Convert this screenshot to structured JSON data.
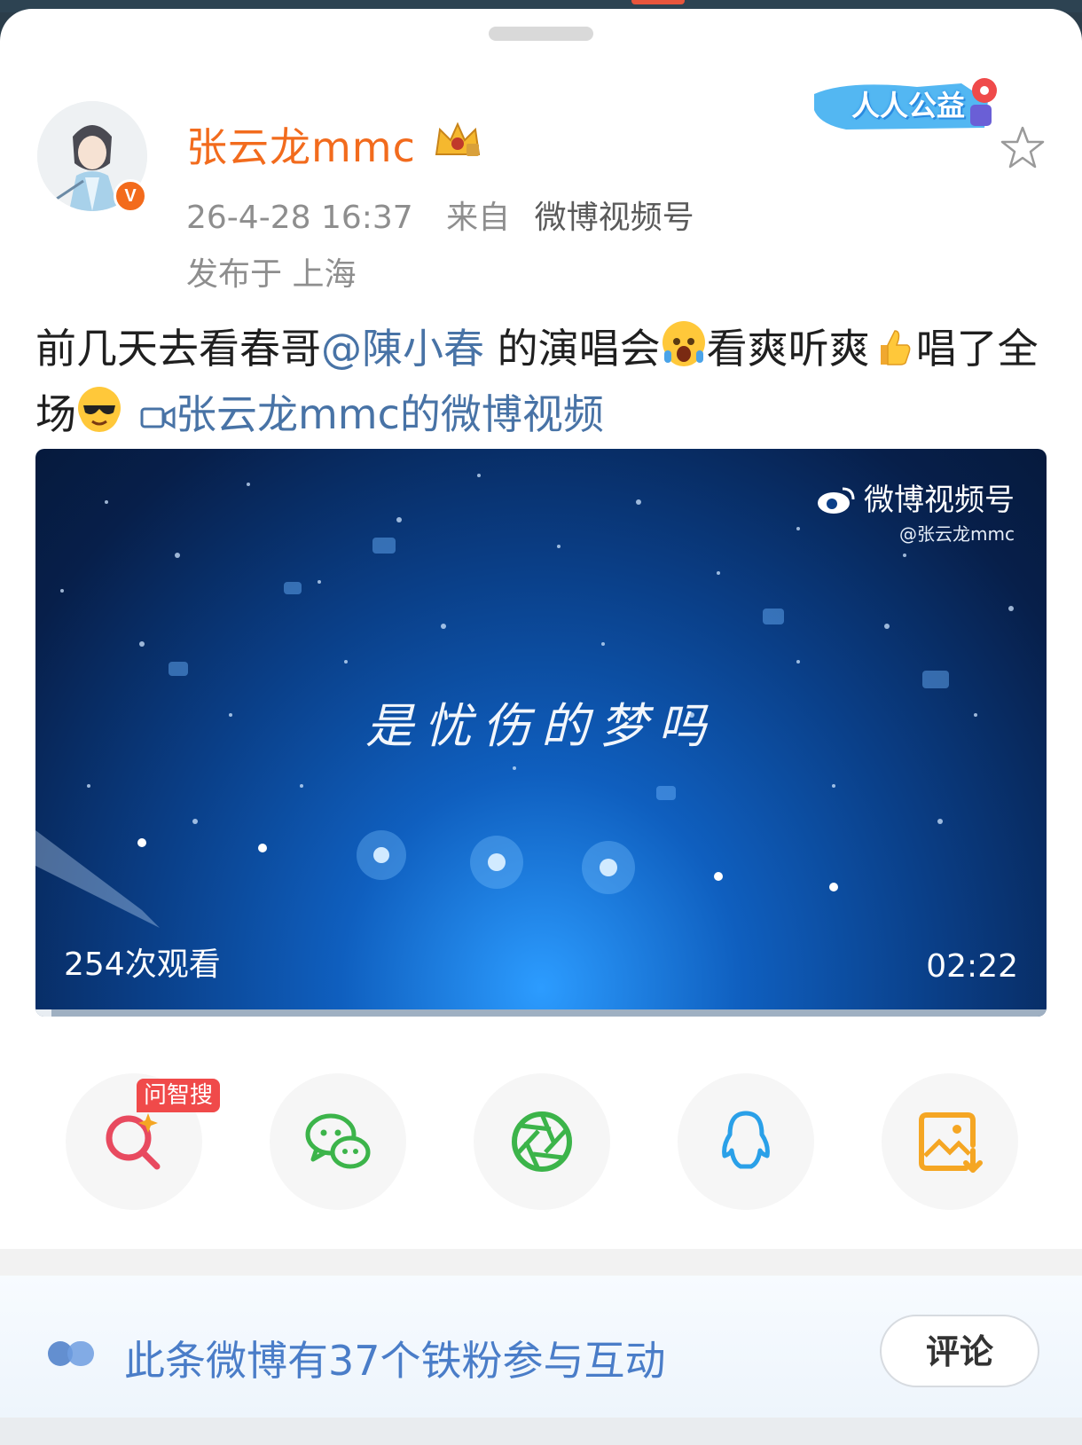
{
  "post": {
    "author": "张云龙mmc",
    "time": "26-4-28 16:37",
    "source_prefix": "来自",
    "source": "微博视频号",
    "location": "发布于 上海",
    "charity_badge": "人人公益",
    "text_part1": "前几天去看春哥",
    "mention": "@陳小春",
    "text_part2": " 的演唱会",
    "text_part3": "看爽听爽",
    "text_part4": "唱了全场",
    "video_link": "张云龙mmc的微博视频"
  },
  "video": {
    "watermark_brand": "微博视频号",
    "watermark_user": "@张云龙mmc",
    "lyric": "是忧伤的梦吗",
    "views": "254次观看",
    "duration": "02:22",
    "progress_fraction": 0.016
  },
  "share": {
    "ai_tag": "问智搜",
    "items": [
      {
        "icon": "ai-search-icon"
      },
      {
        "icon": "wechat-icon"
      },
      {
        "icon": "moments-icon"
      },
      {
        "icon": "qq-icon"
      },
      {
        "icon": "save-image-icon"
      }
    ]
  },
  "footer": {
    "fans_text": "此条微博有37个铁粉参与互动",
    "comment_label": "评论"
  },
  "colors": {
    "author": "#f26b1d",
    "link": "#4873a6",
    "fans_text": "#4a7dc8",
    "ai_tag": "#f04a4a"
  }
}
